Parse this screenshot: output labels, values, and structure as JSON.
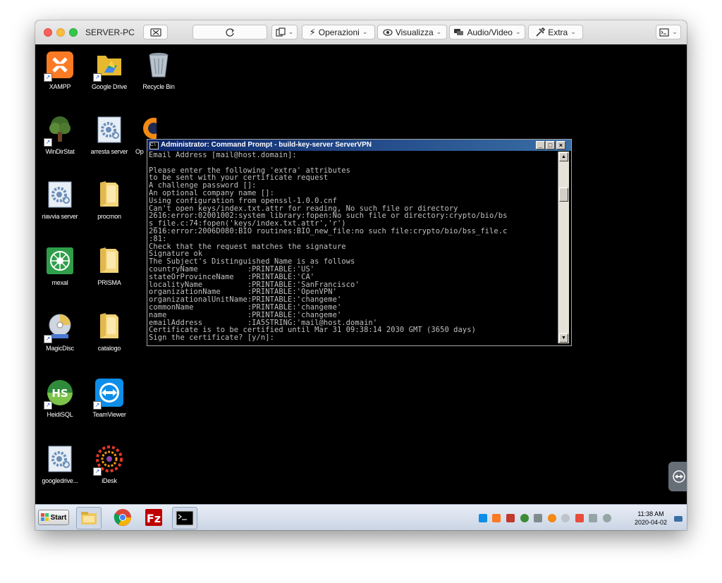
{
  "host_window": {
    "title": "SERVER-PC",
    "toolbar": {
      "operations": "Operazioni",
      "view": "Visualizza",
      "audio_video": "Audio/Video",
      "extra": "Extra"
    }
  },
  "desktop_icons": [
    {
      "label": "XAMPP",
      "icon": "xampp-icon"
    },
    {
      "label": "Google Drive",
      "icon": "google-drive-icon"
    },
    {
      "label": "Recycle Bin",
      "icon": "recycle-bin-icon"
    },
    {
      "label": "WinDirStat",
      "icon": "windirstat-icon"
    },
    {
      "label": "arresta server",
      "icon": "script-gear-icon"
    },
    {
      "label": "Op",
      "icon": "openvpn-icon"
    },
    {
      "label": "riavvia server",
      "icon": "script-gear-icon"
    },
    {
      "label": "procmon",
      "icon": "folder-icon"
    },
    {
      "label": "mexal",
      "icon": "mexal-icon"
    },
    {
      "label": "PRISMA",
      "icon": "folder-icon"
    },
    {
      "label": "MagicDisc",
      "icon": "magicdisc-icon"
    },
    {
      "label": "catalogo",
      "icon": "folder-icon"
    },
    {
      "label": "HeidiSQL",
      "icon": "heidisql-icon"
    },
    {
      "label": "TeamViewer",
      "icon": "teamviewer-icon"
    },
    {
      "label": "googledrive...",
      "icon": "script-gear-icon"
    },
    {
      "label": "iDesk",
      "icon": "idesk-icon"
    }
  ],
  "console": {
    "title": "Administrator: Command Prompt - build-key-server ServerVPN",
    "icon_text": "C:\\",
    "lines": [
      "Email Address [mail@host.domain]:",
      "",
      "Please enter the following 'extra' attributes",
      "to be sent with your certificate request",
      "A challenge password []:",
      "An optional company name []:",
      "Using configuration from openssl-1.0.0.cnf",
      "Can't open keys/index.txt.attr for reading, No such file or directory",
      "2616:error:02001002:system library:fopen:No such file or directory:crypto/bio/bs",
      "s_file.c:74:fopen('keys/index.txt.attr','r')",
      "2616:error:2006D080:BIO routines:BIO_new_file:no such file:crypto/bio/bss_file.c",
      ":81:",
      "Check that the request matches the signature",
      "Signature ok",
      "The Subject's Distinguished Name is as follows",
      "countryName           :PRINTABLE:'US'",
      "stateOrProvinceName   :PRINTABLE:'CA'",
      "localityName          :PRINTABLE:'SanFrancisco'",
      "organizationName      :PRINTABLE:'OpenVPN'",
      "organizationalUnitName:PRINTABLE:'changeme'",
      "commonName            :PRINTABLE:'changeme'",
      "name                  :PRINTABLE:'changeme'",
      "emailAddress          :IA5STRING:'mail@host.domain'",
      "Certificate is to be certified until Mar 31 09:38:14 2030 GMT (3650 days)",
      "Sign the certificate? [y/n]:"
    ]
  },
  "taskbar": {
    "start_label": "Start",
    "apps": [
      "explorer-icon",
      "chrome-icon",
      "filezilla-icon",
      "command-prompt-icon"
    ],
    "tray_icons": [
      "teamviewer-tray-icon",
      "xampp-tray-icon",
      "help-tray-icon",
      "network-tray-icon",
      "usb-tray-icon",
      "openvpn-tray-icon",
      "shield-tray-icon",
      "flag-tray-icon",
      "display-tray-icon",
      "volume-tray-icon"
    ],
    "clock_time": "11:38 AM",
    "clock_date": "2020-04-02"
  }
}
